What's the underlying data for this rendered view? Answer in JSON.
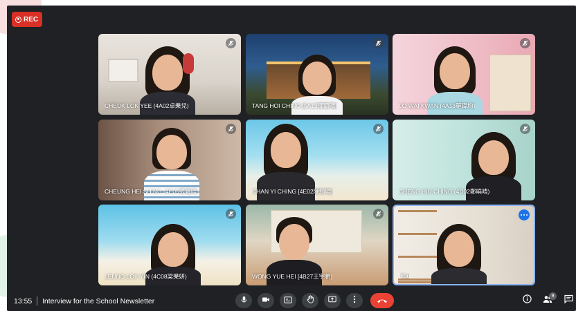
{
  "recording": {
    "label": "REC"
  },
  "participants": [
    {
      "name": "CHEUK LOK YEE (4A02卓樂兒)",
      "muted": true
    },
    {
      "name": "TANG HOI CHING [5A19鄧凱晴]",
      "muted": true
    },
    {
      "name": "LO WAI KWAN (4A13羅瑋均)",
      "muted": true
    },
    {
      "name": "CHEUNG HEI SHING (4E05張曦晴)",
      "muted": true
    },
    {
      "name": "CHAN YI CHING [4E02陳綺晴]",
      "muted": true
    },
    {
      "name": "CHENG HIU CHING (4D02鄭曉晴)",
      "muted": true
    },
    {
      "name": "LEUNG LOK YIN (4C08梁樂妍)",
      "muted": true
    },
    {
      "name": "WONG YUE HEI [4B27王宇希]",
      "muted": true
    },
    {
      "name": "You",
      "muted": false
    }
  ],
  "bottom_bar": {
    "time": "13:55",
    "meeting_title": "Interview for the School Newsletter",
    "controls": [
      "mic-icon",
      "camera-icon",
      "captions-icon",
      "raise-hand-icon",
      "present-icon",
      "more-options-icon",
      "hang-up-icon"
    ],
    "right_controls": [
      "meeting-info-icon",
      "people-icon",
      "chat-icon"
    ],
    "people_count": "9"
  },
  "colors": {
    "stage": "#202124",
    "control": "#3c4043",
    "hangup": "#ea4335",
    "rec": "#d93025",
    "accent": "#1a73e8"
  }
}
